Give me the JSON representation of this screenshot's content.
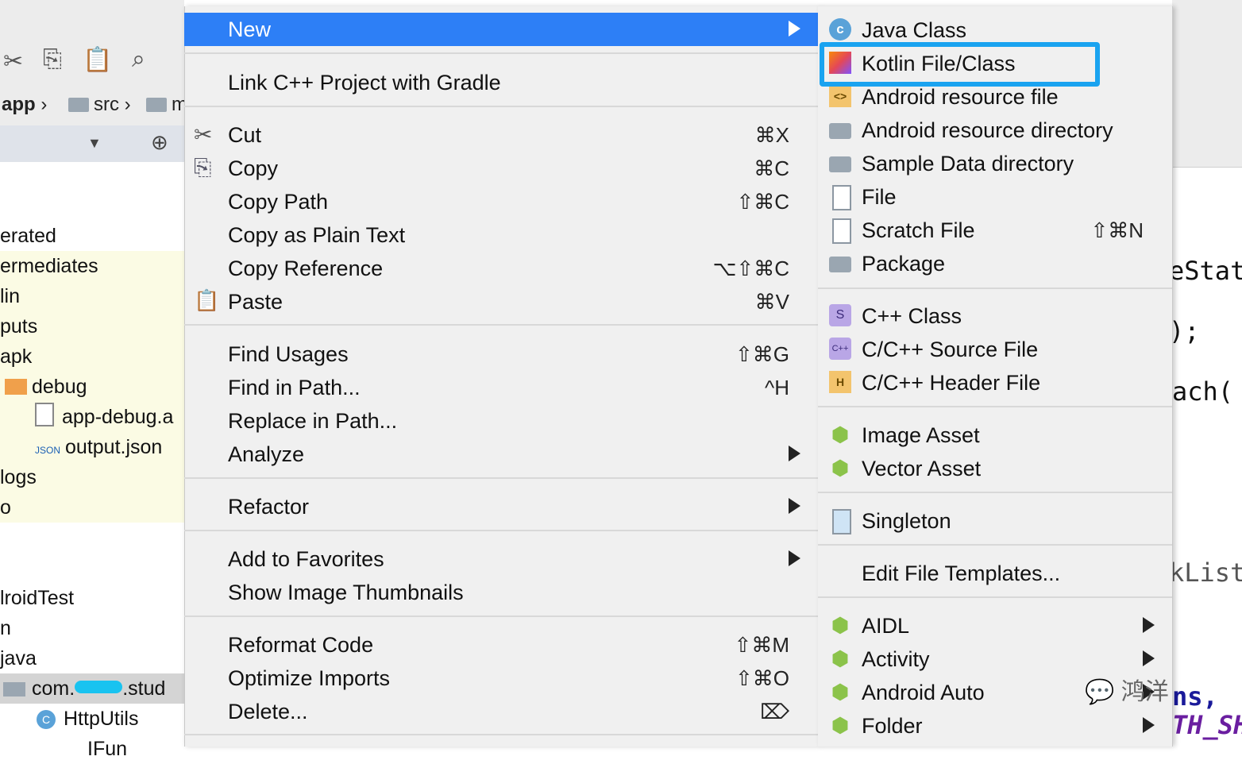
{
  "project_pane": {
    "breadcrumb": [
      "app",
      "src",
      "m"
    ],
    "tree": [
      "erated",
      "ermediates",
      "lin",
      "puts",
      "apk",
      "debug",
      "app-debug.a",
      "output.json",
      "logs",
      "o",
      "lroidTest",
      "n",
      "java",
      "com.",
      ".stud",
      "HttpUtils",
      "IFun"
    ]
  },
  "context_menu": {
    "items": [
      {
        "label": "New",
        "shortcut": "",
        "submenu": true,
        "highlighted": true
      },
      {
        "label": "Link C++ Project with Gradle",
        "shortcut": ""
      },
      {
        "label": "Cut",
        "shortcut": "⌘X",
        "icon": "scissors-icon"
      },
      {
        "label": "Copy",
        "shortcut": "⌘C",
        "icon": "copy-icon"
      },
      {
        "label": "Copy Path",
        "shortcut": "⇧⌘C"
      },
      {
        "label": "Copy as Plain Text",
        "shortcut": ""
      },
      {
        "label": "Copy Reference",
        "shortcut": "⌥⇧⌘C"
      },
      {
        "label": "Paste",
        "shortcut": "⌘V",
        "icon": "paste-icon"
      },
      {
        "label": "Find Usages",
        "shortcut": "⇧⌘G"
      },
      {
        "label": "Find in Path...",
        "shortcut": "^H"
      },
      {
        "label": "Replace in Path...",
        "shortcut": ""
      },
      {
        "label": "Analyze",
        "shortcut": "",
        "submenu": true
      },
      {
        "label": "Refactor",
        "shortcut": "",
        "submenu": true
      },
      {
        "label": "Add to Favorites",
        "shortcut": "",
        "submenu": true
      },
      {
        "label": "Show Image Thumbnails",
        "shortcut": ""
      },
      {
        "label": "Reformat Code",
        "shortcut": "⇧⌘M"
      },
      {
        "label": "Optimize Imports",
        "shortcut": "⇧⌘O"
      },
      {
        "label": "Delete...",
        "shortcut": "⌦"
      }
    ]
  },
  "new_submenu": {
    "items": [
      {
        "label": "Java Class",
        "icon": "java-class-icon"
      },
      {
        "label": "Kotlin File/Class",
        "icon": "kotlin-icon",
        "boxed": true
      },
      {
        "label": "Android resource file",
        "icon": "android-resource-file-icon"
      },
      {
        "label": "Android resource directory",
        "icon": "folder-icon"
      },
      {
        "label": "Sample Data directory",
        "icon": "folder-icon"
      },
      {
        "label": "File",
        "icon": "file-icon"
      },
      {
        "label": "Scratch File",
        "shortcut": "⇧⌘N",
        "icon": "scratch-file-icon"
      },
      {
        "label": "Package",
        "icon": "package-icon"
      },
      {
        "label": "C++ Class",
        "icon": "cpp-class-icon"
      },
      {
        "label": "C/C++ Source File",
        "icon": "cpp-source-icon"
      },
      {
        "label": "C/C++ Header File",
        "icon": "cpp-header-icon"
      },
      {
        "label": "Image Asset",
        "icon": "android-icon"
      },
      {
        "label": "Vector Asset",
        "icon": "android-icon"
      },
      {
        "label": "Singleton",
        "icon": "singleton-icon"
      },
      {
        "label": "Edit File Templates...",
        "icon": ""
      },
      {
        "label": "AIDL",
        "icon": "android-icon",
        "submenu": true
      },
      {
        "label": "Activity",
        "icon": "android-icon",
        "submenu": true
      },
      {
        "label": "Android Auto",
        "icon": "android-icon",
        "submenu": true
      },
      {
        "label": "Folder",
        "icon": "android-icon",
        "submenu": true
      }
    ]
  },
  "editor_fragments": [
    "eStat",
    ");",
    "ach(",
    "kList",
    "ns,",
    "TH_SH"
  ],
  "watermark": "鸿洋",
  "colors": {
    "highlight": "#2d7ff6",
    "callout_box": "#1aa3f0"
  }
}
